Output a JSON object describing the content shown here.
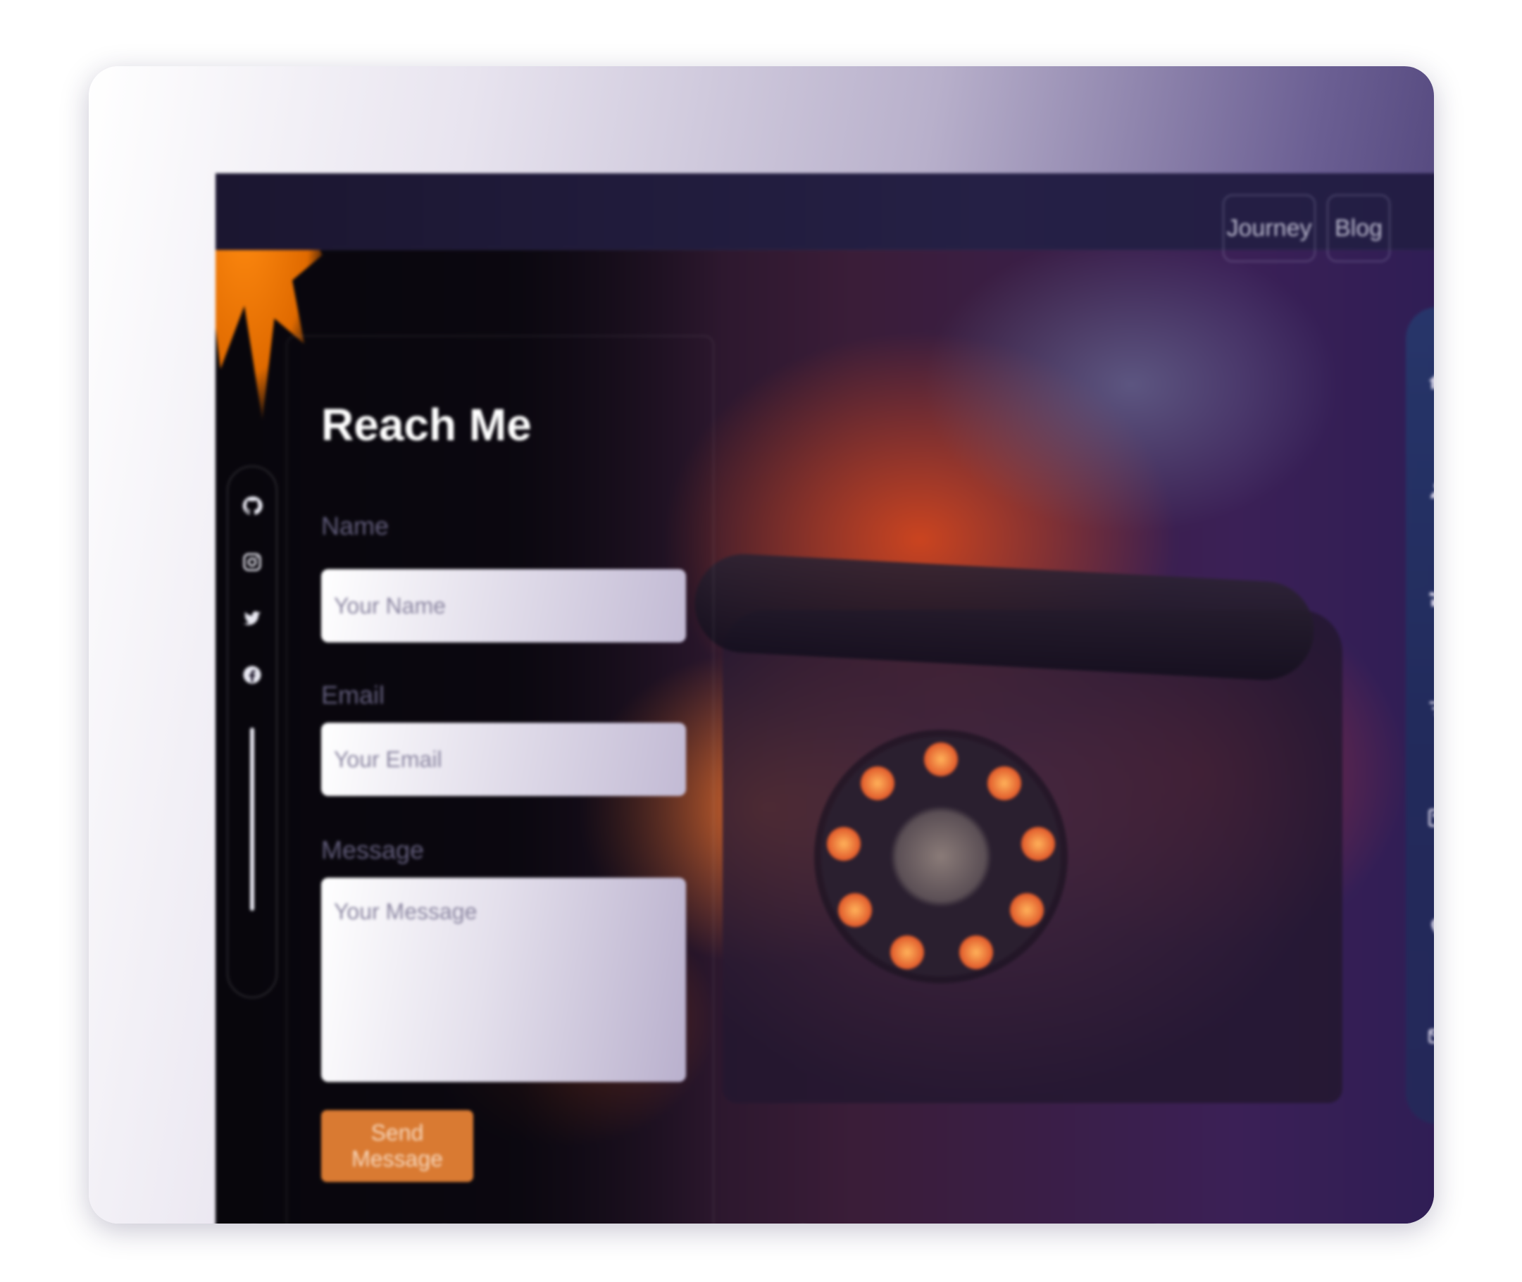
{
  "topbar": {
    "nav": [
      "Journey",
      "Blog"
    ]
  },
  "contact_form": {
    "title": "Reach Me",
    "name_label": "Name",
    "name_placeholder": "Your Name",
    "email_label": "Email",
    "email_placeholder": "Your Email",
    "message_label": "Message",
    "message_placeholder": "Your Message",
    "submit_label": "Send Message"
  },
  "social_links": [
    "github-icon",
    "instagram-icon",
    "twitter-icon",
    "facebook-icon"
  ],
  "side_nav_icons": [
    "home-icon",
    "user-icon",
    "experience-icon",
    "skills-icon",
    "projects-icon",
    "location-icon",
    "contact-icon"
  ],
  "colors": {
    "accent_button": "#d97a32",
    "side_rail": "#263a6e",
    "topbar": "#252045"
  }
}
